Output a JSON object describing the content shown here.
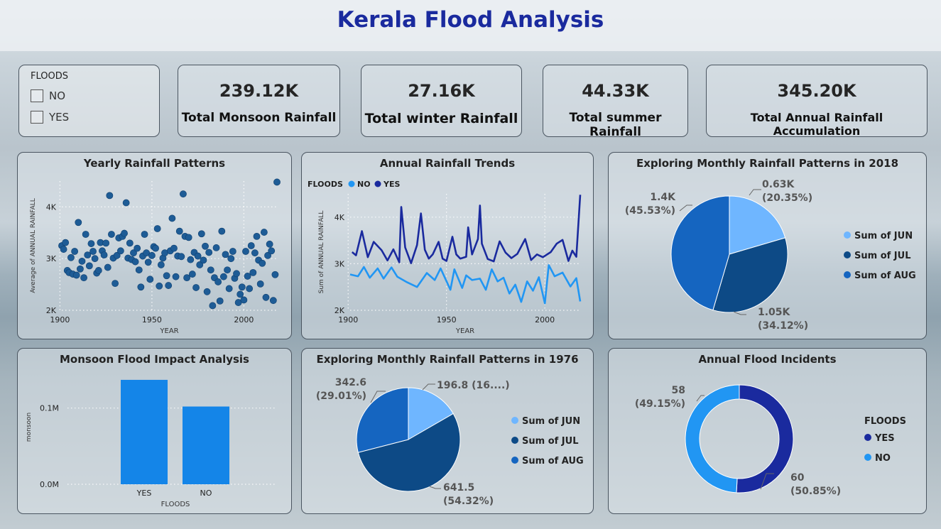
{
  "title": "Kerala Flood Analysis",
  "slicer": {
    "header": "FLOODS",
    "options": [
      "NO",
      "YES"
    ]
  },
  "kpis": [
    {
      "value": "239.12K",
      "label": "Total Monsoon Rainfall"
    },
    {
      "value": "27.16K",
      "label": "Total winter Rainfall"
    },
    {
      "value": "44.33K",
      "label": "Total summer Rainfall"
    },
    {
      "value": "345.20K",
      "label": "Total Annual Rainfall Accumulation"
    }
  ],
  "colors": {
    "yes": "#1a2a9e",
    "no": "#2196f3",
    "jun": "#6fb6ff",
    "jul": "#0d4a86",
    "aug": "#1565c0",
    "bar": "#1485e8",
    "scatter": "#1e5c96"
  },
  "chart_data": [
    {
      "type": "scatter",
      "title": "Yearly Rainfall Patterns",
      "xlabel": "YEAR",
      "ylabel": "Average of ANNUAL RAINFALL",
      "xlim": [
        1901,
        2018
      ],
      "ylim": [
        2000,
        4500
      ],
      "xticks": [
        "1900",
        "1950",
        "2000"
      ],
      "yticks": [
        "2K",
        "3K",
        "4K"
      ],
      "x": [
        1901,
        1902,
        1903,
        1904,
        1905,
        1906,
        1907,
        1908,
        1909,
        1910,
        1911,
        1912,
        1913,
        1914,
        1915,
        1916,
        1917,
        1918,
        1919,
        1920,
        1921,
        1922,
        1923,
        1924,
        1925,
        1926,
        1927,
        1928,
        1929,
        1930,
        1931,
        1932,
        1933,
        1934,
        1935,
        1936,
        1937,
        1938,
        1939,
        1940,
        1941,
        1942,
        1943,
        1944,
        1945,
        1946,
        1947,
        1948,
        1949,
        1950,
        1951,
        1952,
        1953,
        1954,
        1955,
        1956,
        1957,
        1958,
        1959,
        1960,
        1961,
        1962,
        1963,
        1964,
        1965,
        1966,
        1967,
        1968,
        1969,
        1970,
        1971,
        1972,
        1973,
        1974,
        1975,
        1976,
        1977,
        1978,
        1979,
        1980,
        1981,
        1982,
        1983,
        1984,
        1985,
        1986,
        1987,
        1988,
        1989,
        1990,
        1991,
        1992,
        1993,
        1994,
        1995,
        1996,
        1997,
        1998,
        1999,
        2000,
        2001,
        2002,
        2003,
        2004,
        2005,
        2006,
        2007,
        2008,
        2009,
        2010,
        2011,
        2012,
        2013,
        2014,
        2015,
        2016,
        2017,
        2018
      ],
      "y": [
        3250,
        3180,
        3310,
        2770,
        2730,
        3020,
        2700,
        3140,
        2680,
        3700,
        2800,
        2950,
        2630,
        3470,
        3070,
        2860,
        3290,
        3140,
        3000,
        2720,
        2770,
        3310,
        3150,
        3070,
        3300,
        2830,
        4220,
        3470,
        3010,
        2520,
        3060,
        3400,
        3150,
        3430,
        3490,
        4080,
        3010,
        3300,
        2980,
        3110,
        2940,
        3200,
        2780,
        2450,
        3050,
        3470,
        3110,
        2930,
        2600,
        3060,
        3230,
        3200,
        3580,
        2470,
        2880,
        3010,
        3110,
        2670,
        2480,
        3150,
        3780,
        3200,
        2650,
        3050,
        3530,
        3040,
        4250,
        3430,
        2630,
        3410,
        2980,
        2700,
        3120,
        2440,
        3050,
        2880,
        3480,
        2970,
        3240,
        2360,
        3120,
        2780,
        2090,
        2630,
        3210,
        2550,
        2180,
        3530,
        2650,
        3080,
        2780,
        2420,
        3000,
        3140,
        2620,
        2710,
        2150,
        2310,
        2450,
        2200,
        3140,
        2660,
        2420,
        3250,
        2730,
        3110,
        3430,
        2970,
        2510,
        2910,
        3510,
        2250,
        3060,
        3280,
        3150,
        2190,
        2690,
        4480
      ]
    },
    {
      "type": "line",
      "title": "Annual Rainfall Trends",
      "xlabel": "YEAR",
      "ylabel": "Sum of ANNUAL RAINFALL",
      "legend_title": "FLOODS",
      "legend": "top-left",
      "xlim": [
        1901,
        2018
      ],
      "ylim": [
        2000,
        4500
      ],
      "xticks": [
        "1900",
        "1950",
        "2000"
      ],
      "yticks": [
        "2K",
        "3K",
        "4K"
      ],
      "series": [
        {
          "name": "NO",
          "x": [
            1901,
            1905,
            1908,
            1911,
            1915,
            1918,
            1922,
            1925,
            1930,
            1935,
            1940,
            1944,
            1947,
            1952,
            1954,
            1958,
            1960,
            1963,
            1967,
            1970,
            1973,
            1976,
            1979,
            1982,
            1985,
            1988,
            1991,
            1994,
            1997,
            2000,
            2002,
            2005,
            2009,
            2013,
            2016,
            2018
          ],
          "y": [
            2770,
            2730,
            2930,
            2700,
            2900,
            2680,
            2920,
            2720,
            2600,
            2500,
            2800,
            2650,
            2900,
            2440,
            2880,
            2480,
            2750,
            2650,
            2680,
            2440,
            2880,
            2620,
            2700,
            2360,
            2550,
            2180,
            2620,
            2420,
            2710,
            2150,
            2970,
            2730,
            2810,
            2510,
            2690,
            2190
          ]
        },
        {
          "name": "YES",
          "x": [
            1902,
            1904,
            1907,
            1910,
            1913,
            1917,
            1920,
            1923,
            1926,
            1927,
            1929,
            1932,
            1935,
            1937,
            1939,
            1941,
            1943,
            1946,
            1948,
            1950,
            1953,
            1955,
            1957,
            1960,
            1961,
            1963,
            1966,
            1967,
            1968,
            1971,
            1974,
            1977,
            1980,
            1983,
            1986,
            1990,
            1993,
            1996,
            1999,
            2003,
            2006,
            2009,
            2012,
            2014,
            2016,
            2018
          ],
          "y": [
            3250,
            3180,
            3700,
            3140,
            3470,
            3290,
            3070,
            3310,
            3030,
            4220,
            3350,
            3010,
            3400,
            4080,
            3300,
            3110,
            3200,
            3470,
            3110,
            3060,
            3580,
            3200,
            3110,
            3150,
            3780,
            3200,
            3530,
            4250,
            3430,
            3100,
            3050,
            3480,
            3240,
            3120,
            3210,
            3530,
            3080,
            3200,
            3140,
            3250,
            3430,
            3510,
            3060,
            3280,
            3150,
            4480
          ]
        }
      ]
    },
    {
      "type": "pie",
      "title": "Exploring Monthly Rainfall Patterns in 2018",
      "categories": [
        "Sum of JUN",
        "Sum of JUL",
        "Sum of AUG"
      ],
      "values": [
        630,
        1050,
        1400
      ],
      "labels": [
        [
          "0.63K",
          "(20.35%)"
        ],
        [
          "1.05K",
          "(34.12%)"
        ],
        [
          "1.4K",
          "(45.53%)"
        ]
      ],
      "legend": "right"
    },
    {
      "type": "bar",
      "title": "Monsoon Flood Impact Analysis",
      "xlabel": "FLOODS",
      "ylabel": "monsoon",
      "categories": [
        "YES",
        "NO"
      ],
      "values": [
        137000,
        102000
      ],
      "ylim": [
        0,
        150000
      ],
      "yticks": [
        "0.0M",
        "0.1M"
      ]
    },
    {
      "type": "pie",
      "title": "Exploring Monthly Rainfall Patterns in 1976",
      "categories": [
        "Sum of JUN",
        "Sum of JUL",
        "Sum of AUG"
      ],
      "values": [
        196.8,
        641.5,
        342.6
      ],
      "labels": [
        [
          "196.8 (16....)"
        ],
        [
          "641.5",
          "(54.32%)"
        ],
        [
          "342.6",
          "(29.01%)"
        ]
      ],
      "legend": "right"
    },
    {
      "type": "pie",
      "title": "Annual Flood Incidents",
      "legend_title": "FLOODS",
      "categories": [
        "YES",
        "NO"
      ],
      "values": [
        60,
        58
      ],
      "labels": [
        [
          "60",
          "(50.85%)"
        ],
        [
          "58",
          "(49.15%)"
        ]
      ],
      "legend": "right"
    }
  ]
}
